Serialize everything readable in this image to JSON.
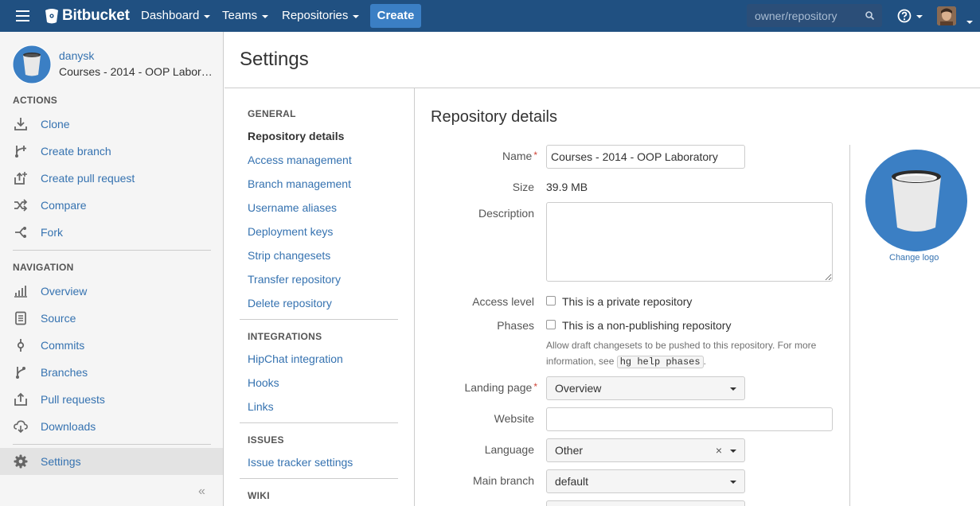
{
  "header": {
    "brand": "Bitbucket",
    "nav": [
      {
        "label": "Dashboard"
      },
      {
        "label": "Teams"
      },
      {
        "label": "Repositories"
      }
    ],
    "create_label": "Create",
    "search_placeholder": "owner/repository",
    "colors": {
      "bar": "#205081",
      "create": "#3b7fc4"
    }
  },
  "sidebar": {
    "owner": "danysk",
    "repo_name": "Courses - 2014 - OOP Laboratory",
    "actions_heading": "ACTIONS",
    "actions": [
      {
        "label": "Clone",
        "icon": "clone-icon"
      },
      {
        "label": "Create branch",
        "icon": "create-branch-icon"
      },
      {
        "label": "Create pull request",
        "icon": "create-pull-request-icon"
      },
      {
        "label": "Compare",
        "icon": "compare-icon"
      },
      {
        "label": "Fork",
        "icon": "fork-icon"
      }
    ],
    "navigation_heading": "NAVIGATION",
    "navigation": [
      {
        "label": "Overview",
        "icon": "overview-icon"
      },
      {
        "label": "Source",
        "icon": "source-icon"
      },
      {
        "label": "Commits",
        "icon": "commits-icon"
      },
      {
        "label": "Branches",
        "icon": "branches-icon"
      },
      {
        "label": "Pull requests",
        "icon": "pull-requests-icon"
      },
      {
        "label": "Downloads",
        "icon": "downloads-icon"
      }
    ],
    "settings_label": "Settings",
    "collapse_glyph": "«"
  },
  "page": {
    "title": "Settings"
  },
  "settings_nav": {
    "general_heading": "GENERAL",
    "general": [
      {
        "label": "Repository details",
        "current": true
      },
      {
        "label": "Access management"
      },
      {
        "label": "Branch management"
      },
      {
        "label": "Username aliases"
      },
      {
        "label": "Deployment keys"
      },
      {
        "label": "Strip changesets"
      },
      {
        "label": "Transfer repository"
      },
      {
        "label": "Delete repository"
      }
    ],
    "integrations_heading": "INTEGRATIONS",
    "integrations": [
      {
        "label": "HipChat integration"
      },
      {
        "label": "Hooks"
      },
      {
        "label": "Links"
      }
    ],
    "issues_heading": "ISSUES",
    "issues": [
      {
        "label": "Issue tracker settings"
      }
    ],
    "wiki_heading": "WIKI"
  },
  "form": {
    "title": "Repository details",
    "name_label": "Name",
    "name_value": "Courses - 2014 - OOP Laboratory",
    "size_label": "Size",
    "size_value": "39.9 MB",
    "description_label": "Description",
    "description_value": "",
    "access_label": "Access level",
    "access_checkbox": "This is a private repository",
    "access_checked": false,
    "phases_label": "Phases",
    "phases_checkbox": "This is a non-publishing repository",
    "phases_checked": false,
    "phases_help_pre": "Allow draft changesets to be pushed to this repository. For more information, see",
    "phases_help_code": "hg help phases",
    "phases_help_post": ".",
    "landing_label": "Landing page",
    "landing_value": "Overview",
    "website_label": "Website",
    "website_value": "",
    "language_label": "Language",
    "language_value": "Other",
    "language_clear": "×",
    "main_branch_label": "Main branch",
    "main_branch_value": "default",
    "required_mark": "*",
    "change_logo": "Change logo"
  }
}
